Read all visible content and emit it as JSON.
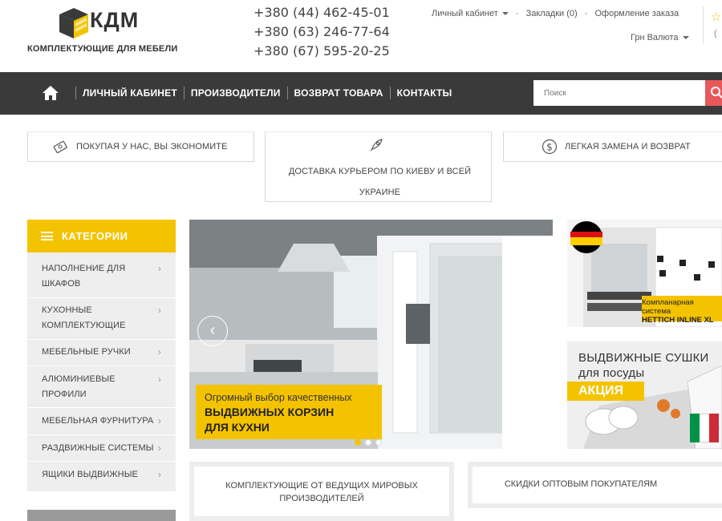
{
  "header": {
    "logo_text": "КДМ",
    "logo_subtitle": "КОМПЛЕКТУЮЩИЕ ДЛЯ МЕБЕЛИ",
    "phones": [
      "+380 (44) 462-45-01",
      "+380 (63) 246-77-64",
      "+380 (67) 595-20-25"
    ],
    "account_label": "Личный кабинет",
    "bookmarks_label": "Закладки (0)",
    "checkout_label": "Оформление заказа",
    "currency_label": "Грн Валюта"
  },
  "nav": {
    "items": [
      "ЛИЧНЫЙ КАБИНЕТ",
      "ПРОИЗВОДИТЕЛИ",
      "ВОЗВРАТ ТОВАРА",
      "КОНТАКТЫ"
    ],
    "search_placeholder": "Поиск"
  },
  "benefits": [
    {
      "text": "ПОКУПАЯ У НАС, ВЫ ЭКОНОМИТЕ",
      "icon": "money-tag-icon"
    },
    {
      "text": "ДОСТАВКА КУРЬЕРОМ ПО КИЕВУ И ВСЕЙ УКРАИНЕ",
      "icon": "rocket-icon"
    },
    {
      "text": "ЛЕГКАЯ ЗАМЕНА И ВОЗВРАТ",
      "icon": "dollar-circle-icon"
    }
  ],
  "sidebar": {
    "title": "КАТЕГОРИИ",
    "items": [
      {
        "label": "НАПОЛНЕНИЕ ДЛЯ ШКАФОВ"
      },
      {
        "label": "КУХОННЫЕ КОМПЛЕКТУЮЩИЕ"
      },
      {
        "label": "МЕБЕЛЬНЫЕ РУЧКИ"
      },
      {
        "label": "АЛЮМИНИЕВЫЕ ПРОФИЛИ"
      },
      {
        "label": "МЕБЕЛЬНАЯ ФУРНИТУРА"
      },
      {
        "label": "РАЗДВИЖНЫЕ СИСТЕМЫ"
      },
      {
        "label": "ЯЩИКИ ВЫДВИЖНЫЕ"
      }
    ]
  },
  "slider": {
    "caption_line1": "Огромный выбор качественных",
    "caption_line2": "ВЫДВИЖНЫХ КОРЗИН",
    "caption_line3": "ДЛЯ КУХНИ",
    "slide_count": 3,
    "active_slide": 1
  },
  "banners": {
    "banner1_line1": "Компланарная",
    "banner1_line2": "система",
    "banner1_line3": "HETTICH INLINE XL",
    "banner2_line1": "ВЫДВИЖНЫЕ СУШКИ",
    "banner2_line2": "для посуды",
    "banner2_badge": "АКЦИЯ"
  },
  "info_boxes": [
    "КОМПЛЕКТУЮЩИЕ ОТ ВЕДУЩИХ МИРОВЫХ ПРОИЗВОДИТЕЛЕЙ",
    "СКИДКИ ОПТОВЫМ ПОКУПАТЕЛЯМ"
  ],
  "colors": {
    "accent": "#f4c300",
    "nav_bg": "#3a3a3a",
    "search_button": "#e8585b"
  }
}
